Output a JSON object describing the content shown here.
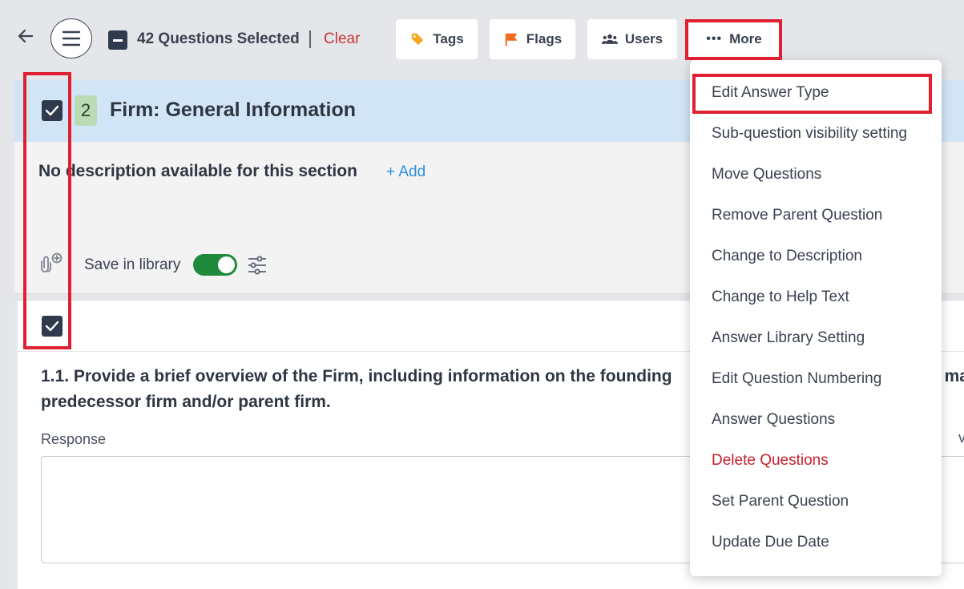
{
  "toolbar": {
    "selected_count_label": "42 Questions Selected",
    "clear_label": "Clear",
    "buttons": {
      "tags": "Tags",
      "flags": "Flags",
      "users": "Users",
      "more": "More"
    },
    "colors": {
      "tag_icon": "#f5a623",
      "flag_icon": "#f26b1d",
      "clear": "#c93636"
    }
  },
  "section": {
    "number": "2",
    "title": "Firm: General Information",
    "description": "No description available for this section",
    "add_label": "Add",
    "save_in_library_label": "Save in library",
    "save_in_library_on": true
  },
  "question": {
    "line1": "1.1. Provide a brief overview of the Firm, including information on the founding",
    "line1_tail": "ma",
    "line2": "predecessor firm and/or parent firm.",
    "response_label": "Response",
    "response_value": ""
  },
  "more_menu": {
    "items": [
      {
        "label": "Edit Answer Type"
      },
      {
        "label": "Sub-question visibility setting"
      },
      {
        "label": "Move Questions"
      },
      {
        "label": "Remove Parent Question"
      },
      {
        "label": "Change to Description"
      },
      {
        "label": "Change to Help Text"
      },
      {
        "label": "Answer Library Setting"
      },
      {
        "label": "Edit Question Numbering"
      },
      {
        "label": "Answer Questions"
      },
      {
        "label": "Delete Questions"
      },
      {
        "label": "Set Parent Question"
      },
      {
        "label": "Update Due Date"
      }
    ]
  }
}
